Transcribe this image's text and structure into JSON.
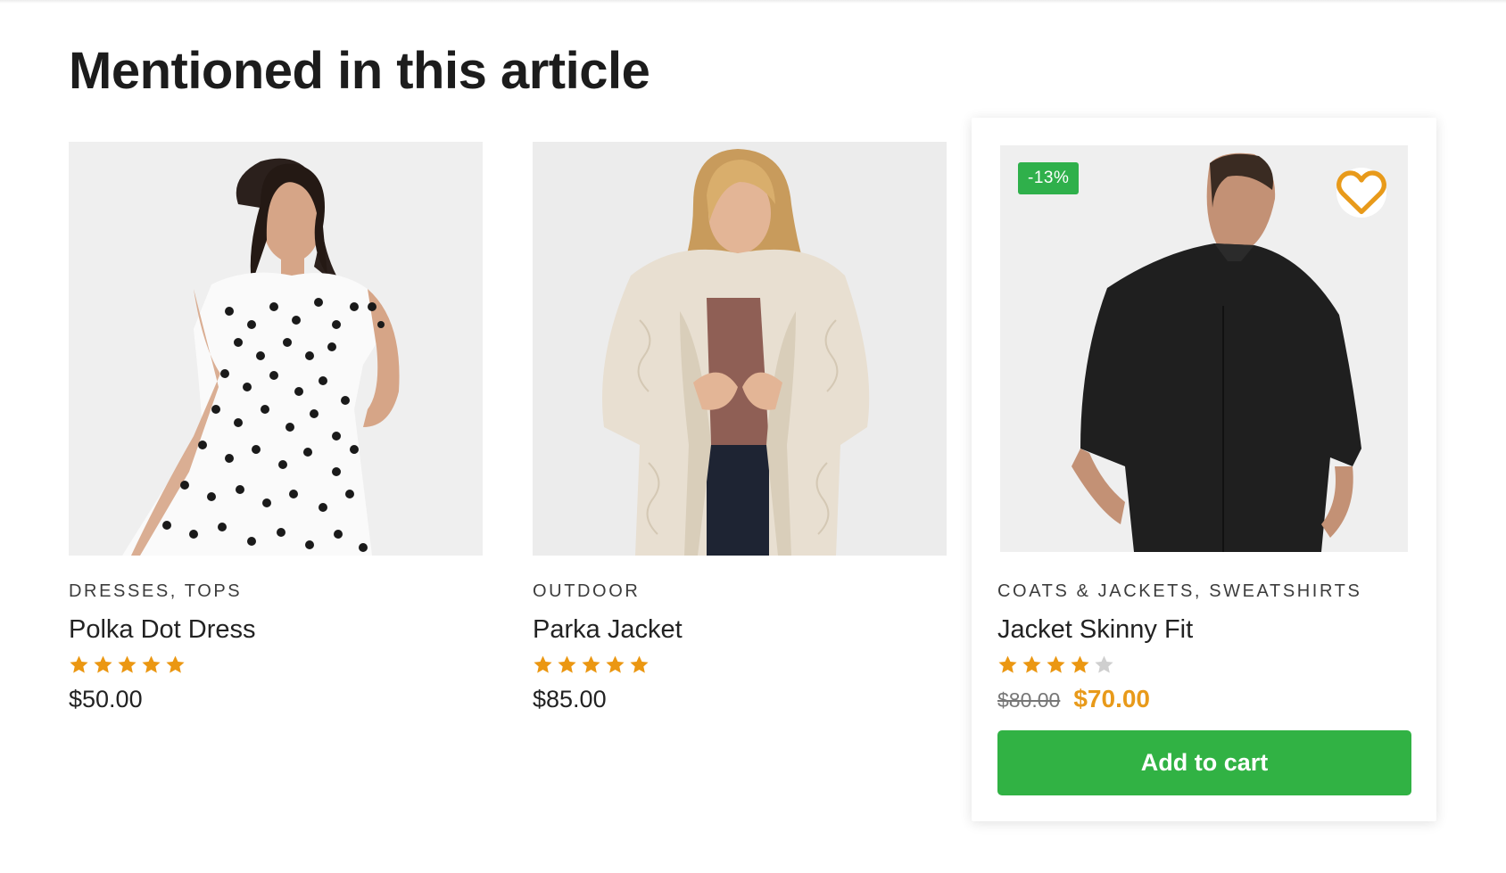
{
  "section": {
    "title": "Mentioned in this article"
  },
  "products": [
    {
      "category": "DRESSES, TOPS",
      "name": "Polka Dot Dress",
      "rating": 5,
      "price": "$50.00"
    },
    {
      "category": "OUTDOOR",
      "name": "Parka Jacket",
      "rating": 5,
      "price": "$85.00"
    },
    {
      "category": "COATS & JACKETS, SWEATSHIRTS",
      "name": "Jacket Skinny Fit",
      "rating": 4,
      "badge": "-13%",
      "old_price": "$80.00",
      "sale_price": "$70.00",
      "add_to_cart_label": "Add to cart"
    }
  ],
  "colors": {
    "star": "#eb9712",
    "star_empty": "#cfcfcf",
    "accent_green": "#31b244",
    "sale_price": "#e89a1a",
    "heart": "#e89a1a"
  },
  "icons": {
    "wishlist": "heart-icon",
    "rating": "star-icon"
  }
}
